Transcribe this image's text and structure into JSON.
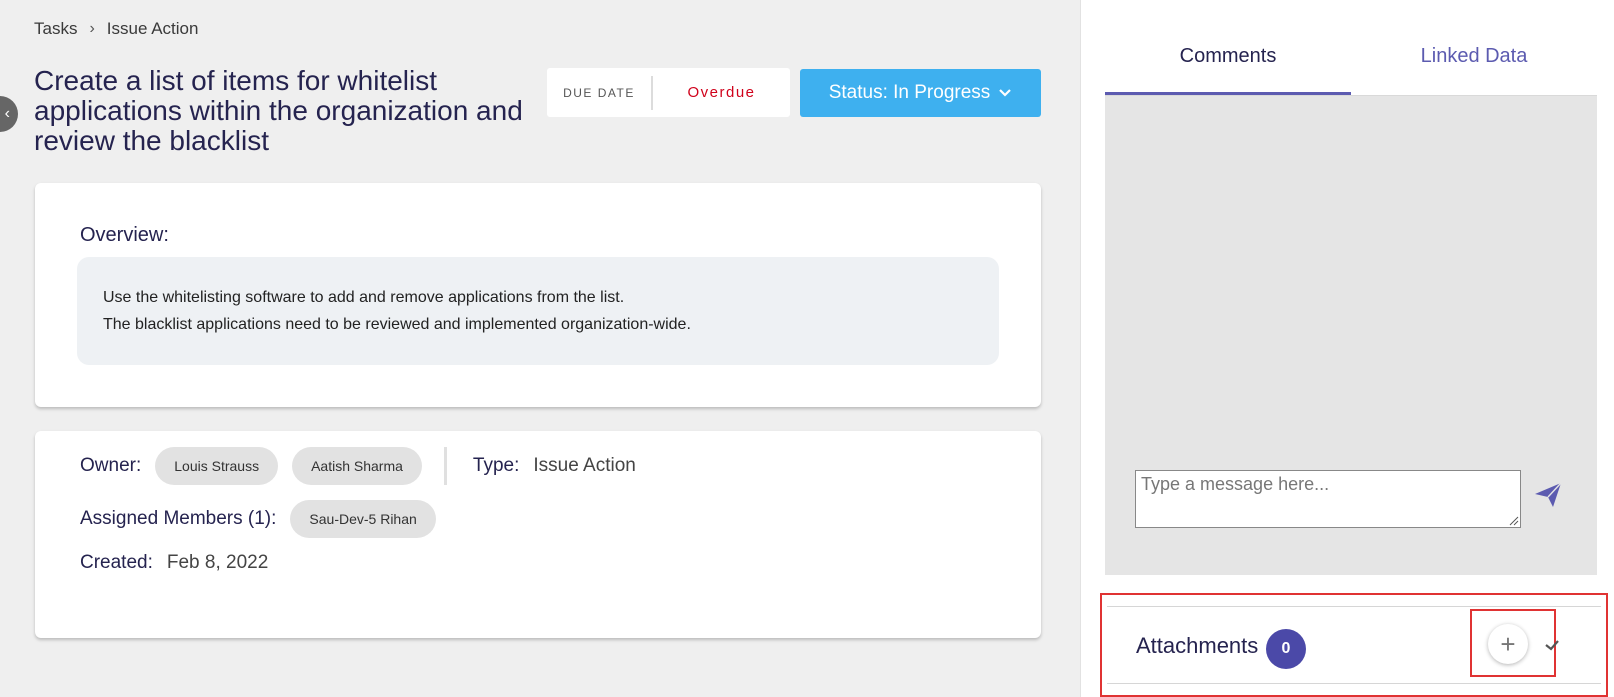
{
  "breadcrumb": {
    "items": [
      "Tasks",
      "Issue Action"
    ],
    "separator": "›"
  },
  "task": {
    "title": "Create a list of items for whitelist applications within the organization and review the blacklist"
  },
  "due": {
    "label": "DUE DATE",
    "value": "Overdue"
  },
  "status": {
    "label": "Status: In Progress"
  },
  "overview": {
    "title": "Overview:",
    "lines": [
      "Use the whitelisting software to add and remove applications from the list.",
      "The blacklist applications need to be reviewed and implemented organization-wide."
    ]
  },
  "meta": {
    "owner_label": "Owner:",
    "owners": [
      "Louis Strauss",
      "Aatish Sharma"
    ],
    "type_label": "Type:",
    "type_value": "Issue Action",
    "assigned_label": "Assigned Members (1):",
    "assigned": [
      "Sau-Dev-5 Rihan"
    ],
    "created_label": "Created:",
    "created_value": "Feb 8, 2022"
  },
  "tabs": [
    {
      "label": "Comments",
      "active": true
    },
    {
      "label": "Linked Data",
      "active": false
    }
  ],
  "chat": {
    "placeholder": "Type a message here..."
  },
  "attachments": {
    "label": "Attachments",
    "count": "0"
  },
  "colors": {
    "accent": "#5c5bb0",
    "status_button": "#3eb0ef",
    "overdue": "#d0021b",
    "highlight": "#e03333",
    "title": "#25234f"
  },
  "icons": {
    "breadcrumb_separator": "chevron-right-icon",
    "back": "chevron-left-icon",
    "status_dropdown": "chevron-down-icon",
    "send": "send-icon",
    "add": "plus-icon",
    "expand": "check-chevron-icon"
  }
}
